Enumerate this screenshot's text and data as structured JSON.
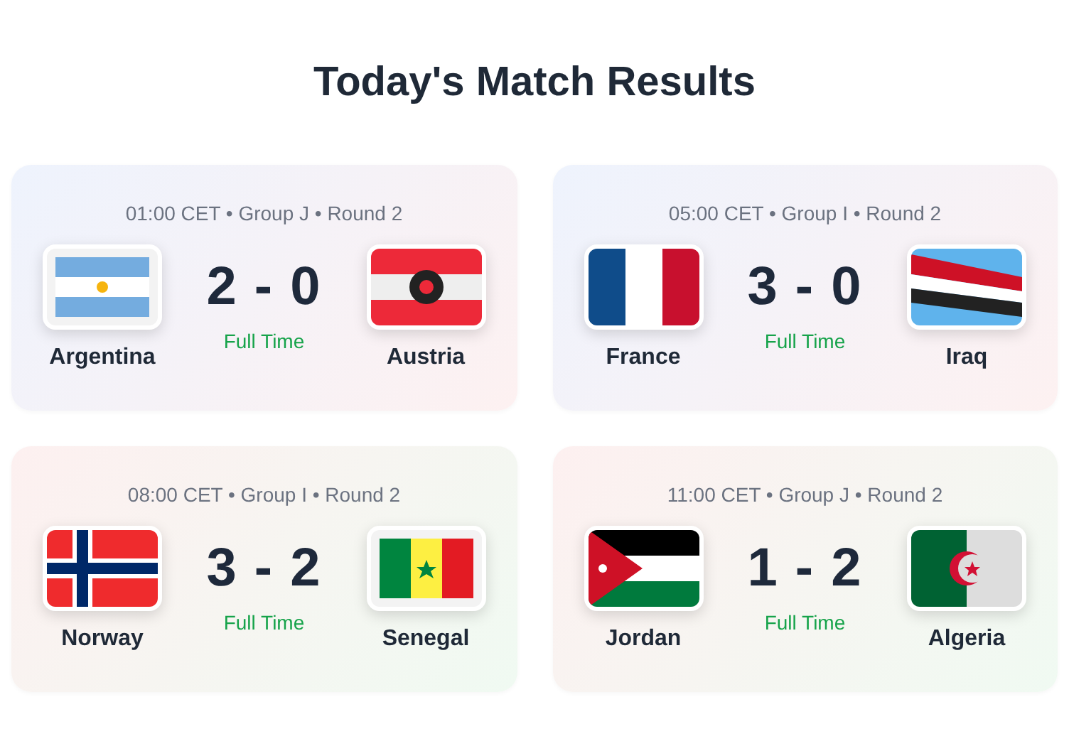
{
  "title": "Today's Match Results",
  "matches": [
    {
      "meta": "01:00 CET • Group J • Round 2",
      "home": "Argentina",
      "score": "2 - 0",
      "away": "Austria",
      "status": "Full Time"
    },
    {
      "meta": "05:00 CET • Group I • Round 2",
      "home": "France",
      "score": "3 - 0",
      "away": "Iraq",
      "status": "Full Time"
    },
    {
      "meta": "08:00 CET • Group I • Round 2",
      "home": "Norway",
      "score": "3 - 2",
      "away": "Senegal",
      "status": "Full Time"
    },
    {
      "meta": "11:00 CET • Group J • Round 2",
      "home": "Jordan",
      "score": "1 - 2",
      "away": "Algeria",
      "status": "Full Time"
    }
  ]
}
